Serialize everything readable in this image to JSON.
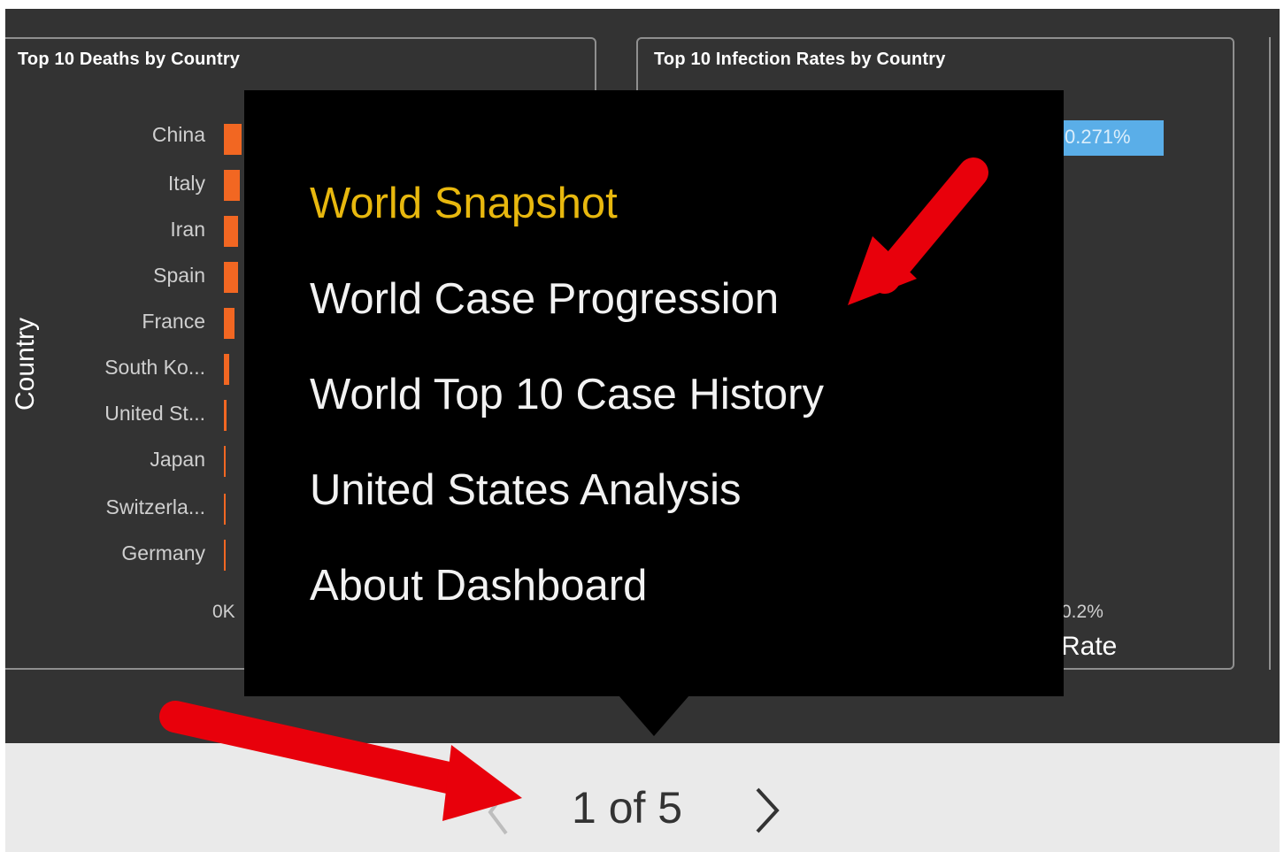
{
  "left_visual": {
    "title": "Top 10 Deaths by Country",
    "y_axis_title": "Country",
    "categories": [
      "China",
      "Italy",
      "Iran",
      "Spain",
      "France",
      "South Ko...",
      "United St...",
      "Japan",
      "Switzerla...",
      "Germany"
    ],
    "x_tick_first": "0K",
    "bar_color": "#f26722"
  },
  "right_visual": {
    "title": "Top 10 Infection Rates by Country",
    "top_bar_label": "0.271%",
    "x_tick": "0.2%",
    "x_axis_title": "Rate",
    "bar_color": "#5aaee8"
  },
  "page_menu": {
    "items": [
      {
        "label": "World Snapshot",
        "active": true
      },
      {
        "label": "World Case Progression",
        "active": false
      },
      {
        "label": "World Top 10 Case History",
        "active": false
      },
      {
        "label": "United States Analysis",
        "active": false
      },
      {
        "label": "About Dashboard",
        "active": false
      }
    ],
    "active_color": "#e8b80e"
  },
  "pager": {
    "text": "1 of 5",
    "prev_icon": "chevron-left-icon",
    "next_icon": "chevron-right-icon"
  },
  "annotations": {
    "arrow_color": "#e8000b"
  }
}
